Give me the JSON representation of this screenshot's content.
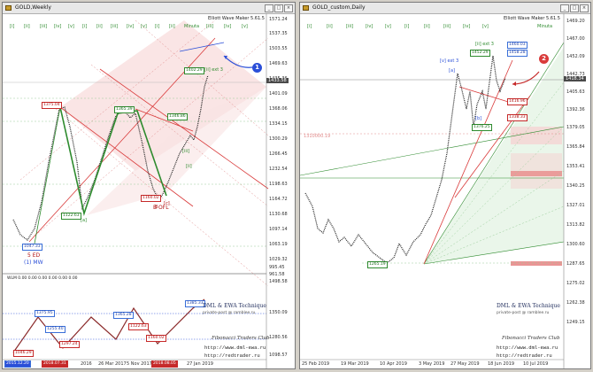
{
  "left": {
    "title": "GOLD,Weekly",
    "indicator": "Elliott Wave Maker 5.61.5",
    "wave_labels_top": [
      "[i]",
      "[ii]",
      "[iii]",
      "[iv]",
      "[v]",
      "[i]",
      "[ii]",
      "[iii]",
      "[iv]",
      "[v]",
      "[i]",
      "[ii]",
      "[iii]",
      "[iv]",
      "[v]",
      "Minuta"
    ],
    "price_axis": [
      "1571.24",
      "1537.35",
      "1503.55",
      "1469.63",
      "1435.36",
      "1401.09",
      "1368.06",
      "1334.15",
      "1300.29",
      "1266.45",
      "1232.54",
      "1198.63",
      "1164.72",
      "1130.68",
      "1097.14",
      "1063.19",
      "1029.32",
      "995.45",
      "961.58"
    ],
    "last_price": "1433.58",
    "annotations": {
      "top_label": "1402.29",
      "ext": "[ii] ext 3",
      "wave_a": "[a]",
      "wave_b": "B",
      "wave_c": "[c]",
      "p1375": "1375.04",
      "p1365": "1365.39",
      "p1346": "1346.86",
      "p1122": "1122.63",
      "p1160": "1160.02",
      "p1047": "1047.33",
      "wave5": "5 ED",
      "wave1mw": "(1) MW",
      "bofl": "B OFL",
      "iii": "[iii]",
      "ii": "[ii]"
    },
    "sub_indicator": "WLM 0.00 0.00 0.00 0.00 0.00 0.00",
    "sub_values": {
      "a": "1375.95",
      "b": "1255.40",
      "c": "1365.28",
      "d": "1297.24",
      "e": "1122.63",
      "f": "1046.29",
      "g": "1160.02",
      "h": "1385.33"
    },
    "sub_axis": [
      "1498.58",
      "1350.09",
      "1280.56",
      "1098.57"
    ],
    "time_axis": [
      "2015.12.20",
      "2018.07.31",
      "2016",
      "26 Mar 2017",
      "5 Nov 2017",
      "2018.08.05",
      "27 Jan 2019"
    ],
    "brand_title": "DML & EWA Technique",
    "brand_sub": "private-post @ ramblee.ru",
    "brand_script": "Fibonacci  Traders  Club",
    "brand_url1": "http://www.dml-ewa.ru",
    "brand_url2": "http://redtrader.ru",
    "marker": "1",
    "colors": {
      "red": "#d93a3a",
      "green": "#2e8b2e",
      "blue": "#2b4fd8",
      "pink": "#f6d0d0"
    }
  },
  "right": {
    "title": "GOLD_custom,Daily",
    "indicator": "Elliott Wave Maker 5.61.5",
    "wave_labels_top": [
      "[i]",
      "[ii]",
      "[iii]",
      "[iv]",
      "[v]",
      "[i]",
      "[ii]",
      "[iii]",
      "[iv]",
      "[v]",
      "Minuta"
    ],
    "price_axis": [
      "1469.20",
      "1467.00",
      "1452.09",
      "1442.73",
      "1405.63",
      "1392.36",
      "1379.05",
      "1365.84",
      "1353.41",
      "1340.25",
      "1327.01",
      "1313.82",
      "1300.60",
      "1287.65",
      "1275.02",
      "1262.38",
      "1249.15"
    ],
    "last_price": "1418.34",
    "annotations": {
      "ext": "[ii] ext 3",
      "lbl_top": "1452.29",
      "lbl_a": "[a]",
      "lbl_b": "[b]",
      "lbl_c": "1376.25",
      "lbl_low": "1265.19",
      "lbl_left": "1310000.19",
      "p1": "1460.03",
      "p2": "1458.28",
      "p3": "1416.96",
      "p4": "1338.33",
      "v": "[v] ext 3"
    },
    "time_axis": [
      "25 Feb 2019",
      "19 Mar 2019",
      "10 Apr 2019",
      "3 May 2019",
      "27 May 2019",
      "18 Jun 2019",
      "10 Jul 2019"
    ],
    "brand_title": "DML & EWA Technique",
    "brand_sub": "private-post @ ramblee.ru",
    "brand_script": "Fibonacci  Traders  Club",
    "brand_url1": "http://www.dml-ewa.ru",
    "brand_url2": "http://redtrader.ru",
    "marker": "2"
  }
}
